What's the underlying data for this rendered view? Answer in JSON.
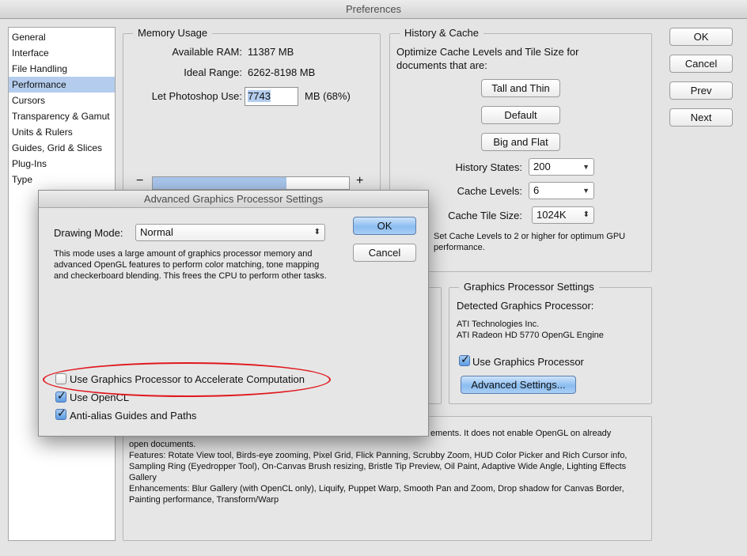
{
  "window": {
    "title": "Preferences"
  },
  "sidebar": {
    "items": [
      {
        "label": "General",
        "selected": false
      },
      {
        "label": "Interface",
        "selected": false
      },
      {
        "label": "File Handling",
        "selected": false
      },
      {
        "label": "Performance",
        "selected": true
      },
      {
        "label": "Cursors",
        "selected": false
      },
      {
        "label": "Transparency & Gamut",
        "selected": false
      },
      {
        "label": "Units & Rulers",
        "selected": false
      },
      {
        "label": "Guides, Grid & Slices",
        "selected": false
      },
      {
        "label": "Plug-Ins",
        "selected": false
      },
      {
        "label": "Type",
        "selected": false
      }
    ]
  },
  "buttons": {
    "ok": "OK",
    "cancel": "Cancel",
    "prev": "Prev",
    "next": "Next"
  },
  "memory": {
    "title": "Memory Usage",
    "available_label": "Available RAM:",
    "available_value": "11387 MB",
    "ideal_label": "Ideal Range:",
    "ideal_value": "6262-8198 MB",
    "let_label": "Let Photoshop Use:",
    "let_value": "7743",
    "let_unit": "MB (68%)",
    "minus": "−",
    "plus": "+",
    "slider_fraction": 0.68
  },
  "history": {
    "title": "History & Cache",
    "description": "Optimize Cache Levels and Tile Size for documents that are:",
    "tall_thin": "Tall and Thin",
    "default": "Default",
    "big_flat": "Big and Flat",
    "history_states_label": "History States:",
    "history_states_value": "200",
    "cache_levels_label": "Cache Levels:",
    "cache_levels_value": "6",
    "tile_size_label": "Cache Tile Size:",
    "tile_size_value": "1024K",
    "note": "Set Cache Levels to 2 or higher for optimum GPU performance."
  },
  "gpu": {
    "title": "Graphics Processor Settings",
    "detected_label": "Detected Graphics Processor:",
    "vendor": "ATI Technologies Inc.",
    "model": "ATI Radeon HD 5770 OpenGL Engine",
    "use_gpu_label": "Use Graphics Processor",
    "use_gpu_checked": true,
    "advanced_button": "Advanced Settings..."
  },
  "description": {
    "line1_tail": "ements. It does not enable OpenGL on already",
    "line2": "open documents.",
    "features": "Features: Rotate View tool, Birds-eye zooming, Pixel Grid, Flick Panning, Scrubby Zoom, HUD Color Picker and Rich Cursor info, Sampling Ring (Eyedropper Tool), On-Canvas Brush resizing, Bristle Tip Preview, Oil Paint, Adaptive Wide Angle, Lighting Effects Gallery",
    "enhancements": "Enhancements: Blur Gallery (with OpenCL only), Liquify, Puppet Warp, Smooth Pan and Zoom, Drop shadow for Canvas Border, Painting performance, Transform/Warp"
  },
  "dialog": {
    "title": "Advanced Graphics Processor Settings",
    "drawing_mode_label": "Drawing Mode:",
    "drawing_mode_value": "Normal",
    "mode_description": "This mode uses a large amount of graphics processor memory and advanced OpenGL features to perform color matching, tone mapping and checkerboard blending.  This frees the CPU to perform other tasks.",
    "ok": "OK",
    "cancel": "Cancel",
    "use_gpu_compute_label": "Use Graphics Processor to Accelerate Computation",
    "use_gpu_compute_checked": false,
    "use_opencl_label": "Use OpenCL",
    "use_opencl_checked": true,
    "antialias_label": "Anti-alias Guides and Paths",
    "antialias_checked": true
  },
  "colors": {
    "accent_blue": "#8bbdf0",
    "selection": "#b4cdee",
    "highlight_oval": "#e0181e"
  }
}
